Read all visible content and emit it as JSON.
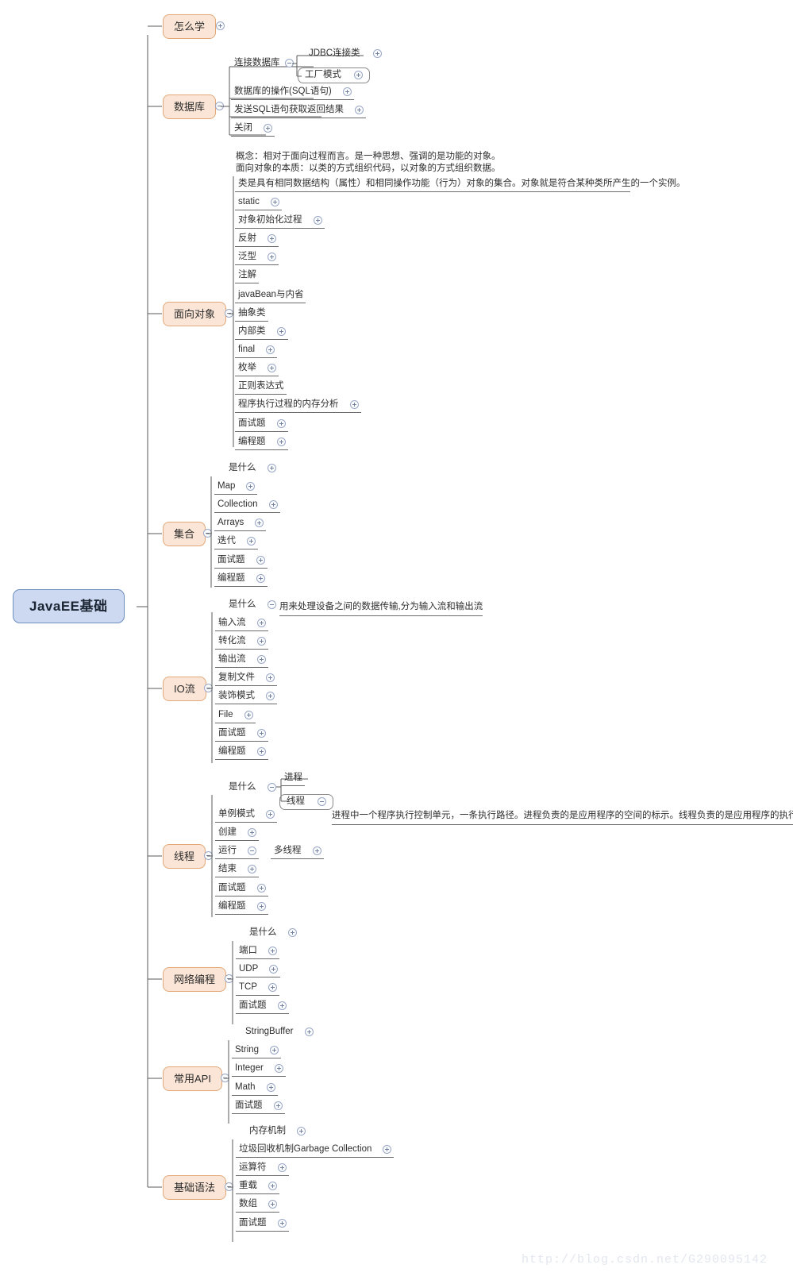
{
  "root": {
    "label": "JavaEE基础",
    "color": "#ccd9f0",
    "border": "#6f8fbf"
  },
  "theme": {
    "branch_fill": "#fbe5d6",
    "branch_border": "#e2a879",
    "line": "#5a5a5a",
    "toggle_border": "#9aa7c4"
  },
  "watermark": "http://blog.csdn.net/G290095142",
  "branches": [
    {
      "label": "怎么学",
      "toggle": "plus",
      "children": []
    },
    {
      "label": "数据库",
      "toggle": "minus",
      "children": [
        {
          "label": "连接数据库",
          "toggle": "minus",
          "children": [
            {
              "label": "JDBC连接类",
              "toggle": "plus"
            },
            {
              "label": "工厂模式",
              "toggle": "plus",
              "boxed": true
            }
          ]
        },
        {
          "label": "数据库的操作(SQL语句)",
          "toggle": "plus"
        },
        {
          "label": "发送SQL语句获取返回结果",
          "toggle": "plus"
        },
        {
          "label": "关闭",
          "toggle": "plus"
        }
      ]
    },
    {
      "label": "面向对象",
      "toggle": "minus",
      "note_lines": [
        "概念：相对于面向过程而言。是一种思想、强调的是功能的对象。",
        "面向对象的本质：以类的方式组织代码，以对象的方式组织数据。"
      ],
      "children": [
        {
          "label": "类是具有相同数据结构（属性）和相同操作功能（行为）对象的集合。对象就是符合某种类所产生的一个实例。",
          "toggle": "none"
        },
        {
          "label": "static",
          "toggle": "plus"
        },
        {
          "label": "对象初始化过程",
          "toggle": "plus"
        },
        {
          "label": "反射",
          "toggle": "plus"
        },
        {
          "label": "泛型",
          "toggle": "plus"
        },
        {
          "label": "注解",
          "toggle": "none"
        },
        {
          "label": "javaBean与内省",
          "toggle": "none"
        },
        {
          "label": "抽象类",
          "toggle": "none"
        },
        {
          "label": "内部类",
          "toggle": "plus"
        },
        {
          "label": "final",
          "toggle": "plus"
        },
        {
          "label": "枚举",
          "toggle": "plus"
        },
        {
          "label": "正则表达式",
          "toggle": "none"
        },
        {
          "label": "程序执行过程的内存分析",
          "toggle": "plus"
        },
        {
          "label": "面试题",
          "toggle": "plus"
        },
        {
          "label": "编程题",
          "toggle": "plus"
        }
      ]
    },
    {
      "label": "集合",
      "toggle": "minus",
      "children": [
        {
          "label": "是什么",
          "toggle": "plus",
          "first": true
        },
        {
          "label": "Map",
          "toggle": "plus"
        },
        {
          "label": "Collection",
          "toggle": "plus"
        },
        {
          "label": "Arrays",
          "toggle": "plus"
        },
        {
          "label": "迭代",
          "toggle": "plus"
        },
        {
          "label": "面试题",
          "toggle": "plus"
        },
        {
          "label": "编程题",
          "toggle": "plus"
        }
      ]
    },
    {
      "label": "IO流",
      "toggle": "minus",
      "children": [
        {
          "label": "是什么",
          "toggle": "minus",
          "first": true,
          "note": "用来处理设备之间的数据传输,分为输入流和输出流"
        },
        {
          "label": "输入流",
          "toggle": "plus"
        },
        {
          "label": "转化流",
          "toggle": "plus"
        },
        {
          "label": "输出流",
          "toggle": "plus"
        },
        {
          "label": "复制文件",
          "toggle": "plus"
        },
        {
          "label": "装饰模式",
          "toggle": "plus"
        },
        {
          "label": "File",
          "toggle": "plus"
        },
        {
          "label": "面试题",
          "toggle": "plus"
        },
        {
          "label": "编程题",
          "toggle": "plus"
        }
      ]
    },
    {
      "label": "线程",
      "toggle": "minus",
      "children": [
        {
          "label": "是什么",
          "toggle": "minus",
          "first": true,
          "sub": [
            {
              "label": "进程",
              "toggle": "none"
            },
            {
              "label": "线程",
              "toggle": "minus",
              "boxed": true,
              "note": "进程中一个程序执行控制单元，一条执行路径。进程负责的是应用程序的空间的标示。线程负责的是应用程序的执行顺序。"
            }
          ]
        },
        {
          "label": "单例模式",
          "toggle": "plus"
        },
        {
          "label": "创建",
          "toggle": "plus"
        },
        {
          "label": "运行",
          "toggle": "minus",
          "sub_inline": {
            "label": "多线程",
            "toggle": "plus"
          }
        },
        {
          "label": "结束",
          "toggle": "plus"
        },
        {
          "label": "面试题",
          "toggle": "plus"
        },
        {
          "label": "编程题",
          "toggle": "plus"
        }
      ]
    },
    {
      "label": "网络编程",
      "toggle": "minus",
      "children": [
        {
          "label": "是什么",
          "toggle": "plus",
          "first": true
        },
        {
          "label": "端口",
          "toggle": "plus"
        },
        {
          "label": "UDP",
          "toggle": "plus"
        },
        {
          "label": "TCP",
          "toggle": "plus"
        },
        {
          "label": "面试题",
          "toggle": "plus"
        }
      ]
    },
    {
      "label": "常用API",
      "toggle": "minus",
      "children": [
        {
          "label": "StringBuffer",
          "toggle": "plus",
          "first": true
        },
        {
          "label": "String",
          "toggle": "plus"
        },
        {
          "label": "Integer",
          "toggle": "plus"
        },
        {
          "label": "Math",
          "toggle": "plus"
        },
        {
          "label": "面试题",
          "toggle": "plus"
        }
      ]
    },
    {
      "label": "基础语法",
      "toggle": "minus",
      "children": [
        {
          "label": "内存机制",
          "toggle": "plus",
          "first": true
        },
        {
          "label": "垃圾回收机制Garbage Collection",
          "toggle": "plus"
        },
        {
          "label": "运算符",
          "toggle": "plus"
        },
        {
          "label": "重载",
          "toggle": "plus"
        },
        {
          "label": "数组",
          "toggle": "plus"
        },
        {
          "label": "面试题",
          "toggle": "plus"
        }
      ]
    }
  ]
}
